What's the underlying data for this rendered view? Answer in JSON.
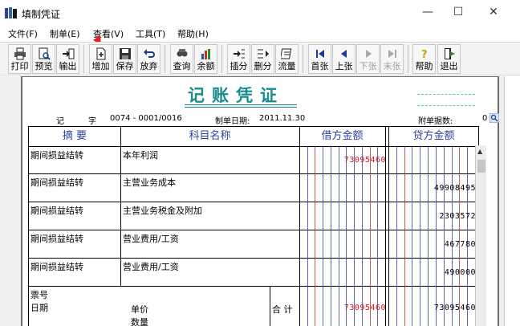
{
  "window": {
    "title": "填制凭证",
    "min_glyph": "—",
    "max_glyph": "☐",
    "close_glyph": "✕"
  },
  "menu": [
    {
      "label": "文件(F)"
    },
    {
      "label": "制单(E)"
    },
    {
      "label": "查看(V)"
    },
    {
      "label": "工具(T)"
    },
    {
      "label": "帮助(H)"
    }
  ],
  "toolbar": [
    {
      "label": "打印",
      "icon": "printer-icon",
      "enabled": true
    },
    {
      "label": "预览",
      "icon": "preview-icon",
      "enabled": true
    },
    {
      "label": "输出",
      "icon": "export-icon",
      "enabled": true
    },
    {
      "label": "增加",
      "icon": "add-icon",
      "enabled": true
    },
    {
      "label": "保存",
      "icon": "save-icon",
      "enabled": true
    },
    {
      "label": "放弃",
      "icon": "undo-icon",
      "enabled": true
    },
    {
      "label": "查询",
      "icon": "search-icon",
      "enabled": true
    },
    {
      "label": "余额",
      "icon": "balance-icon",
      "enabled": true
    },
    {
      "label": "插分",
      "icon": "insert-row-icon",
      "enabled": true
    },
    {
      "label": "删分",
      "icon": "delete-row-icon",
      "enabled": true
    },
    {
      "label": "流量",
      "icon": "cashflow-icon",
      "enabled": true
    },
    {
      "label": "首张",
      "icon": "first-page-icon",
      "enabled": true
    },
    {
      "label": "上张",
      "icon": "prev-page-icon",
      "enabled": true
    },
    {
      "label": "下张",
      "icon": "next-page-icon",
      "enabled": false
    },
    {
      "label": "末张",
      "icon": "last-page-icon",
      "enabled": false
    },
    {
      "label": "帮助",
      "icon": "help-icon",
      "enabled": true
    },
    {
      "label": "退出",
      "icon": "exit-icon",
      "enabled": true
    }
  ],
  "voucher": {
    "title": "记账凭证",
    "type_label": "记",
    "type_label2": "字",
    "number": "0074 - 0001/0016",
    "date_label": "制单日期:",
    "date_value": "2011.11.30",
    "attach_label": "附单据数:",
    "attach_value": "0"
  },
  "table": {
    "headers": {
      "summary": "摘 要",
      "account": "科目名称",
      "debit": "借方金额",
      "credit": "贷方金额"
    },
    "rows": [
      {
        "summary": "期间损益结转",
        "account": "本年利润",
        "debit": "73095460",
        "credit": ""
      },
      {
        "summary": "期间损益结转",
        "account": "主营业务成本",
        "debit": "",
        "credit": "49908495"
      },
      {
        "summary": "期间损益结转",
        "account": "主营业务税金及附加",
        "debit": "",
        "credit": "2303572"
      },
      {
        "summary": "期间损益结转",
        "account": "营业费用/工资",
        "debit": "",
        "credit": "467780"
      },
      {
        "summary": "期间损益结转",
        "account": "营业费用/工资",
        "debit": "",
        "credit": "490000"
      }
    ],
    "footer": {
      "ticket_no_label": "票号",
      "date_label": "日期",
      "unit_price_label": "单价",
      "quantity_label": "数量",
      "total_label": "合 计",
      "total_debit": "73095460",
      "total_credit": "73095460"
    }
  },
  "colors": {
    "accent_teal": "#188c8c",
    "header_blue": "#3040a0",
    "debit_red": "#d01818",
    "arrow_red": "#e02020"
  }
}
